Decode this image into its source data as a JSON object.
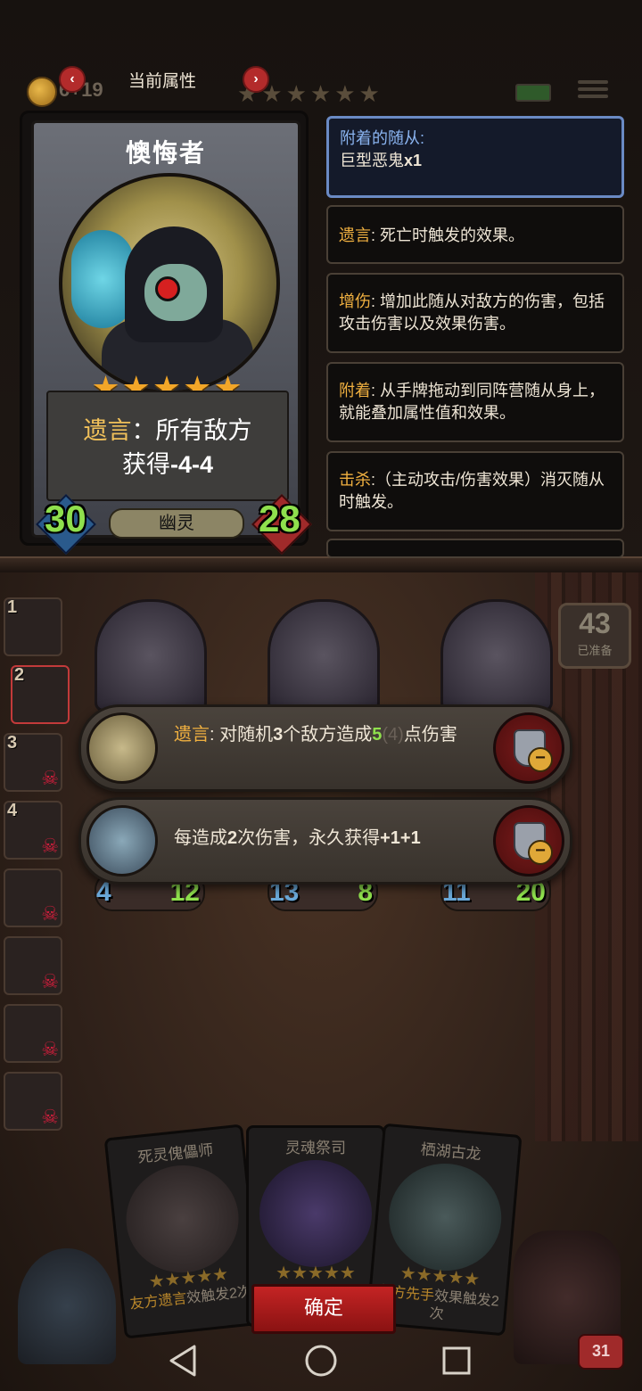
{
  "hud": {
    "gold": "6+19",
    "stars": "★★★★★★"
  },
  "attribute_header": {
    "title": "当前属性",
    "prev_arrow": "‹",
    "next_arrow": "›"
  },
  "character_card": {
    "name": "懊悔者",
    "stars": "★★★★★",
    "ability_keyword": "遗言",
    "ability_line1": "：所有敌方",
    "ability_line2_prefix": "获得",
    "ability_line2_value": "-4-4",
    "attack": "30",
    "health": "28",
    "tribe": "幽灵"
  },
  "info_panels": {
    "attached_label": "附着的随从:",
    "attached_value": "巨型恶鬼",
    "attached_count": "x1",
    "deathrattle_kw": "遗言",
    "deathrattle_desc": ": 死亡时触发的效果。",
    "damage_kw": "增伤",
    "damage_desc": ": 增加此随从对敌方的伤害，包括攻击伤害以及效果伤害。",
    "attach_kw": "附着",
    "attach_desc": ": 从手牌拖动到同阵营随从身上，就能叠加属性值和效果。",
    "kill_kw": "击杀",
    "kill_desc": ":（主动攻击/伤害效果）消灭随从时触发。"
  },
  "side_slots": [
    "1",
    "2",
    "3",
    "4",
    "",
    "",
    "",
    ""
  ],
  "board_minions": [
    {
      "attack": "4",
      "health": "12"
    },
    {
      "attack": "13",
      "health": "8"
    },
    {
      "attack": "11",
      "health": "20"
    }
  ],
  "ready_counter": {
    "count": "43",
    "label": "已准备"
  },
  "effects": [
    {
      "kw": "遗言",
      "pre": ": 对随机",
      "count": "3",
      "mid": "个敌方造成",
      "value": "5",
      "dim": "(4)",
      "post": "点伤害"
    },
    {
      "pre": "每造成",
      "count": "2",
      "mid": "次伤害，永久获得",
      "value": "+1+1"
    }
  ],
  "hand_cards": [
    {
      "name": "死灵傀儡师",
      "stars": "★★★★★",
      "desc_kw": "友方遗言",
      "desc": "效触发2次"
    },
    {
      "name": "灵魂祭司",
      "stars": "★★★★★",
      "desc_kw": "",
      "desc": ""
    },
    {
      "name": "栖湖古龙",
      "stars": "★★★★★",
      "desc_kw": "友方先手",
      "desc": "效果触发2次"
    }
  ],
  "confirm_label": "确定",
  "player_hp": "31",
  "colors": {
    "accent_red": "#c42424",
    "keyword_gold": "#f0b040",
    "stat_green": "#8fe04d",
    "highlight_blue": "#6a8ac4"
  },
  "icons": {
    "nav_back": "back-triangle-icon",
    "nav_home": "home-circle-icon",
    "nav_recent": "recent-square-icon"
  }
}
